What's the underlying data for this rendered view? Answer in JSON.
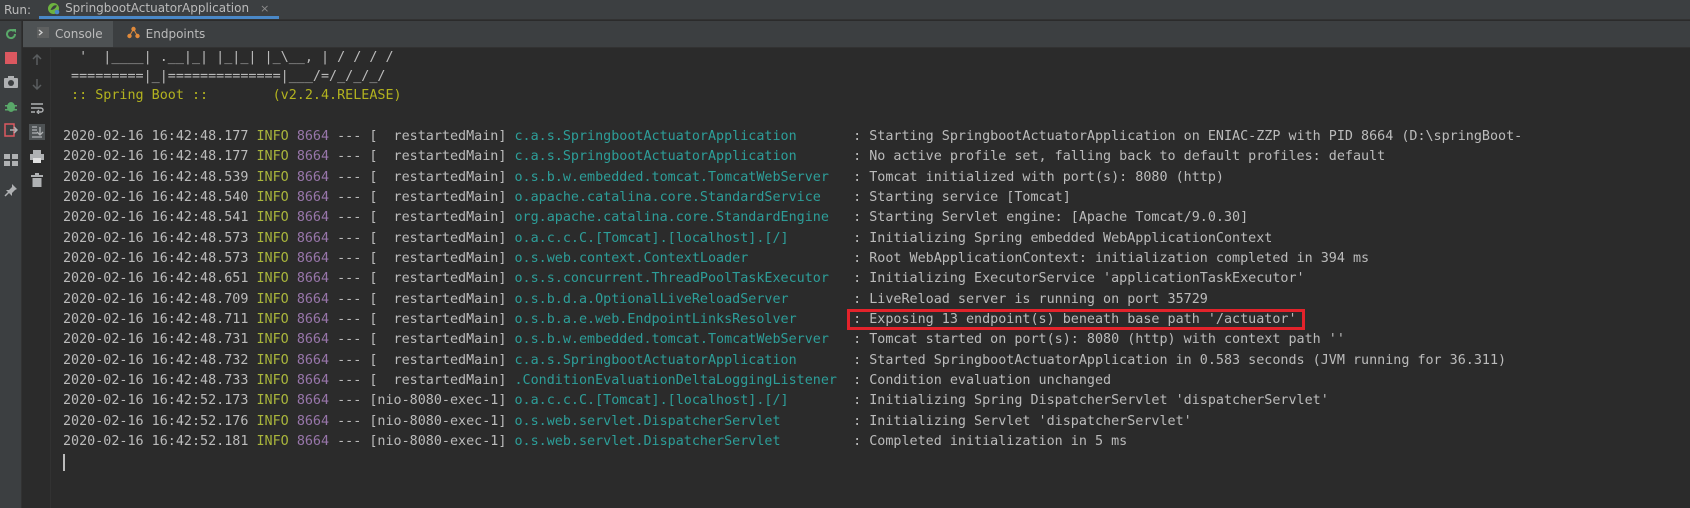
{
  "run_bar": {
    "label": "Run:",
    "tab_title": "SpringbootActuatorApplication",
    "close_glyph": "×"
  },
  "subtabs": [
    {
      "label": "Console",
      "icon": "console-icon"
    },
    {
      "label": "Endpoints",
      "icon": "endpoints-icon"
    }
  ],
  "banner": [
    "  '  |____| .__|_| |_|_| |_\\__, | / / / /",
    " =========|_|==============|___/=/_/_/_/",
    " :: Spring Boot ::        (v2.2.4.RELEASE)"
  ],
  "logs": [
    {
      "ts": "2020-02-16 16:42:48.177",
      "level": "INFO",
      "pid": "8664",
      "sep": "---",
      "thread": "[  restartedMain]",
      "logger": "c.a.s.SpringbootActuatorApplication      ",
      "msg": ": Starting SpringbootActuatorApplication on ENIAC-ZZP with PID 8664 (D:\\springBoot-"
    },
    {
      "ts": "2020-02-16 16:42:48.177",
      "level": "INFO",
      "pid": "8664",
      "sep": "---",
      "thread": "[  restartedMain]",
      "logger": "c.a.s.SpringbootActuatorApplication      ",
      "msg": ": No active profile set, falling back to default profiles: default"
    },
    {
      "ts": "2020-02-16 16:42:48.539",
      "level": "INFO",
      "pid": "8664",
      "sep": "---",
      "thread": "[  restartedMain]",
      "logger": "o.s.b.w.embedded.tomcat.TomcatWebServer  ",
      "msg": ": Tomcat initialized with port(s): 8080 (http)"
    },
    {
      "ts": "2020-02-16 16:42:48.540",
      "level": "INFO",
      "pid": "8664",
      "sep": "---",
      "thread": "[  restartedMain]",
      "logger": "o.apache.catalina.core.StandardService   ",
      "msg": ": Starting service [Tomcat]"
    },
    {
      "ts": "2020-02-16 16:42:48.541",
      "level": "INFO",
      "pid": "8664",
      "sep": "---",
      "thread": "[  restartedMain]",
      "logger": "org.apache.catalina.core.StandardEngine  ",
      "msg": ": Starting Servlet engine: [Apache Tomcat/9.0.30]"
    },
    {
      "ts": "2020-02-16 16:42:48.573",
      "level": "INFO",
      "pid": "8664",
      "sep": "---",
      "thread": "[  restartedMain]",
      "logger": "o.a.c.c.C.[Tomcat].[localhost].[/]       ",
      "msg": ": Initializing Spring embedded WebApplicationContext"
    },
    {
      "ts": "2020-02-16 16:42:48.573",
      "level": "INFO",
      "pid": "8664",
      "sep": "---",
      "thread": "[  restartedMain]",
      "logger": "o.s.web.context.ContextLoader            ",
      "msg": ": Root WebApplicationContext: initialization completed in 394 ms"
    },
    {
      "ts": "2020-02-16 16:42:48.651",
      "level": "INFO",
      "pid": "8664",
      "sep": "---",
      "thread": "[  restartedMain]",
      "logger": "o.s.s.concurrent.ThreadPoolTaskExecutor  ",
      "msg": ": Initializing ExecutorService 'applicationTaskExecutor'"
    },
    {
      "ts": "2020-02-16 16:42:48.709",
      "level": "INFO",
      "pid": "8664",
      "sep": "---",
      "thread": "[  restartedMain]",
      "logger": "o.s.b.d.a.OptionalLiveReloadServer       ",
      "msg": ": LiveReload server is running on port 35729"
    },
    {
      "ts": "2020-02-16 16:42:48.711",
      "level": "INFO",
      "pid": "8664",
      "sep": "---",
      "thread": "[  restartedMain]",
      "logger": "o.s.b.a.e.web.EndpointLinksResolver      ",
      "msg": ": Exposing 13 endpoint(s) beneath base path '/actuator'",
      "highlight": true
    },
    {
      "ts": "2020-02-16 16:42:48.731",
      "level": "INFO",
      "pid": "8664",
      "sep": "---",
      "thread": "[  restartedMain]",
      "logger": "o.s.b.w.embedded.tomcat.TomcatWebServer  ",
      "msg": ": Tomcat started on port(s): 8080 (http) with context path ''"
    },
    {
      "ts": "2020-02-16 16:42:48.732",
      "level": "INFO",
      "pid": "8664",
      "sep": "---",
      "thread": "[  restartedMain]",
      "logger": "c.a.s.SpringbootActuatorApplication      ",
      "msg": ": Started SpringbootActuatorApplication in 0.583 seconds (JVM running for 36.311)"
    },
    {
      "ts": "2020-02-16 16:42:48.733",
      "level": "INFO",
      "pid": "8664",
      "sep": "---",
      "thread": "[  restartedMain]",
      "logger": ".ConditionEvaluationDeltaLoggingListener ",
      "msg": ": Condition evaluation unchanged"
    },
    {
      "ts": "2020-02-16 16:42:52.173",
      "level": "INFO",
      "pid": "8664",
      "sep": "---",
      "thread": "[nio-8080-exec-1]",
      "logger": "o.a.c.c.C.[Tomcat].[localhost].[/]       ",
      "msg": ": Initializing Spring DispatcherServlet 'dispatcherServlet'"
    },
    {
      "ts": "2020-02-16 16:42:52.176",
      "level": "INFO",
      "pid": "8664",
      "sep": "---",
      "thread": "[nio-8080-exec-1]",
      "logger": "o.s.web.servlet.DispatcherServlet        ",
      "msg": ": Initializing Servlet 'dispatcherServlet'"
    },
    {
      "ts": "2020-02-16 16:42:52.181",
      "level": "INFO",
      "pid": "8664",
      "sep": "---",
      "thread": "[nio-8080-exec-1]",
      "logger": "o.s.web.servlet.DispatcherServlet        ",
      "msg": ": Completed initialization in 5 ms"
    }
  ],
  "colors": {
    "background": "#2b2b2b",
    "info": "#a9b53c",
    "pid": "#9876aa",
    "logger": "#2d9e99",
    "spring_banner": "#b3b31f",
    "highlight": "#e3232b"
  },
  "left_toolbar_icons": [
    "rerun-icon",
    "stop-icon",
    "camera-icon",
    "debug-bug-icon",
    "exit-icon",
    "layout-icon",
    "pin-icon"
  ],
  "console_gutter_icons": [
    "up-arrow-icon",
    "down-arrow-icon",
    "soft-wrap-icon",
    "scroll-to-end-icon",
    "print-icon",
    "trash-icon"
  ]
}
